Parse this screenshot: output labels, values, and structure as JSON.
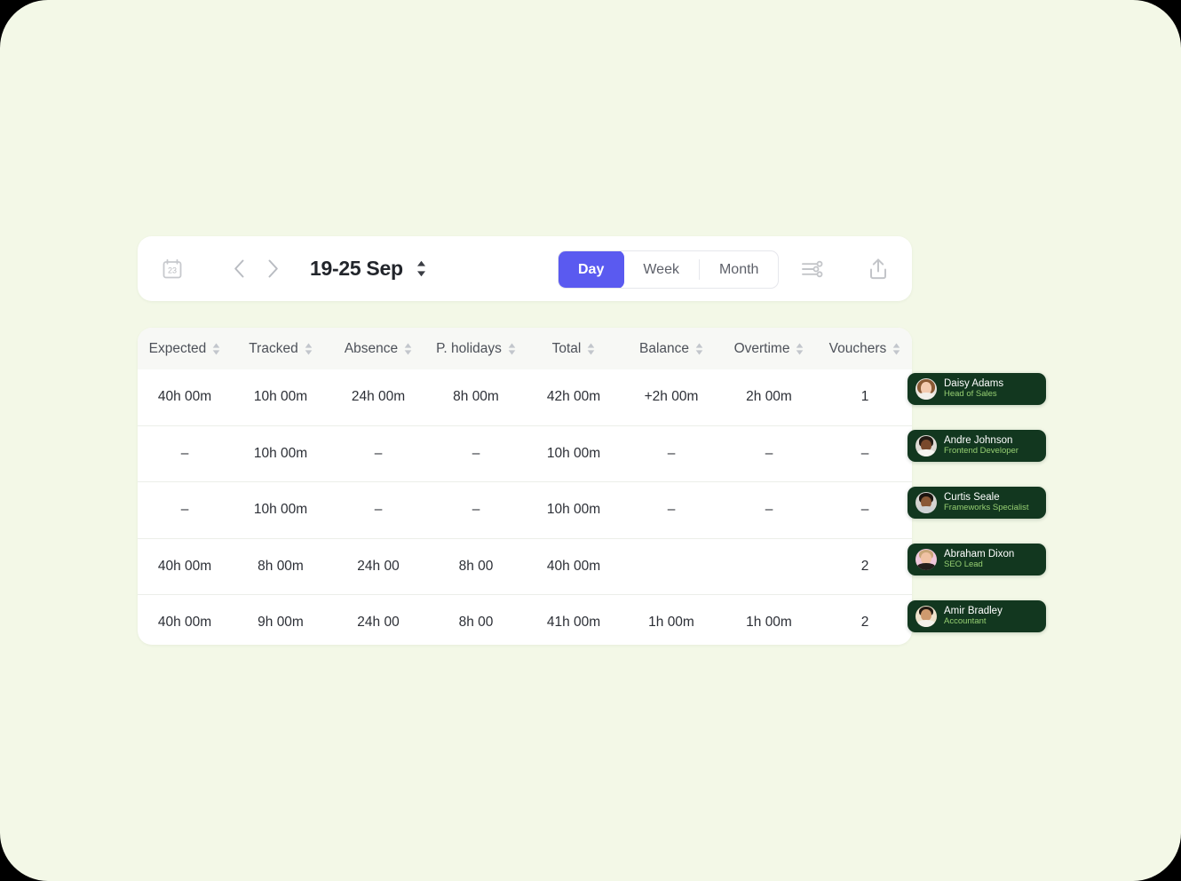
{
  "toolbar": {
    "calendar_icon_day": "23",
    "prev_label": "previous period",
    "next_label": "next period",
    "date_range": "19-25 Sep",
    "view_options": [
      {
        "label": "Day",
        "active": true
      },
      {
        "label": "Week",
        "active": false
      },
      {
        "label": "Month",
        "active": false
      }
    ],
    "filter_icon": "sliders-icon",
    "export_icon": "upload-icon"
  },
  "table": {
    "columns": [
      {
        "key": "expected",
        "label": "Expected",
        "sortable": true
      },
      {
        "key": "tracked",
        "label": "Tracked",
        "sortable": true
      },
      {
        "key": "absence",
        "label": "Absence",
        "sortable": true
      },
      {
        "key": "pholi",
        "label": "P.  holidays",
        "sortable": true
      },
      {
        "key": "total",
        "label": "Total",
        "sortable": true
      },
      {
        "key": "balance",
        "label": "Balance",
        "sortable": true
      },
      {
        "key": "overtime",
        "label": "Overtime",
        "sortable": true
      },
      {
        "key": "vouchers",
        "label": "Vouchers",
        "sortable": true
      }
    ],
    "rows": [
      {
        "expected": "40h 00m",
        "tracked": "10h 00m",
        "absence": "24h 00m",
        "pholi": "8h 00m",
        "total": "42h 00m",
        "balance": "+2h 00m",
        "balance_positive": true,
        "overtime": "2h 00m",
        "vouchers": "1"
      },
      {
        "expected": "–",
        "tracked": "10h 00m",
        "absence": "–",
        "pholi": "–",
        "total": "10h 00m",
        "balance": "–",
        "balance_positive": false,
        "overtime": "–",
        "vouchers": "–"
      },
      {
        "expected": "–",
        "tracked": "10h 00m",
        "absence": "–",
        "pholi": "–",
        "total": "10h 00m",
        "balance": "–",
        "balance_positive": false,
        "overtime": "–",
        "vouchers": "–"
      },
      {
        "expected": "40h 00m",
        "tracked": "8h 00m",
        "absence": "24h 00",
        "pholi": "8h 00",
        "total": "40h 00m",
        "balance": "",
        "balance_positive": false,
        "overtime": "",
        "vouchers": "2"
      },
      {
        "expected": "40h 00m",
        "tracked": "9h 00m",
        "absence": "24h 00",
        "pholi": "8h 00",
        "total": "41h 00m",
        "balance": "1h 00m",
        "balance_positive": false,
        "overtime": "1h 00m",
        "vouchers": "2"
      }
    ]
  },
  "employees": [
    {
      "name": "Daisy Adams",
      "role": "Head of Sales"
    },
    {
      "name": "Andre Johnson",
      "role": "Frontend Developer"
    },
    {
      "name": "Curtis Seale",
      "role": "Frameworks Specialist"
    },
    {
      "name": "Abraham Dixon",
      "role": "SEO Lead"
    },
    {
      "name": "Amir Bradley",
      "role": "Accountant"
    }
  ],
  "colors": {
    "page_background": "#f3f8e7",
    "card_background": "#ffffff",
    "accent_active": "#5a5af0",
    "positive_balance": "#3ddc72",
    "badge_background": "#12371f",
    "badge_role_text": "#96cf72",
    "header_background": "#f7f8f5"
  }
}
